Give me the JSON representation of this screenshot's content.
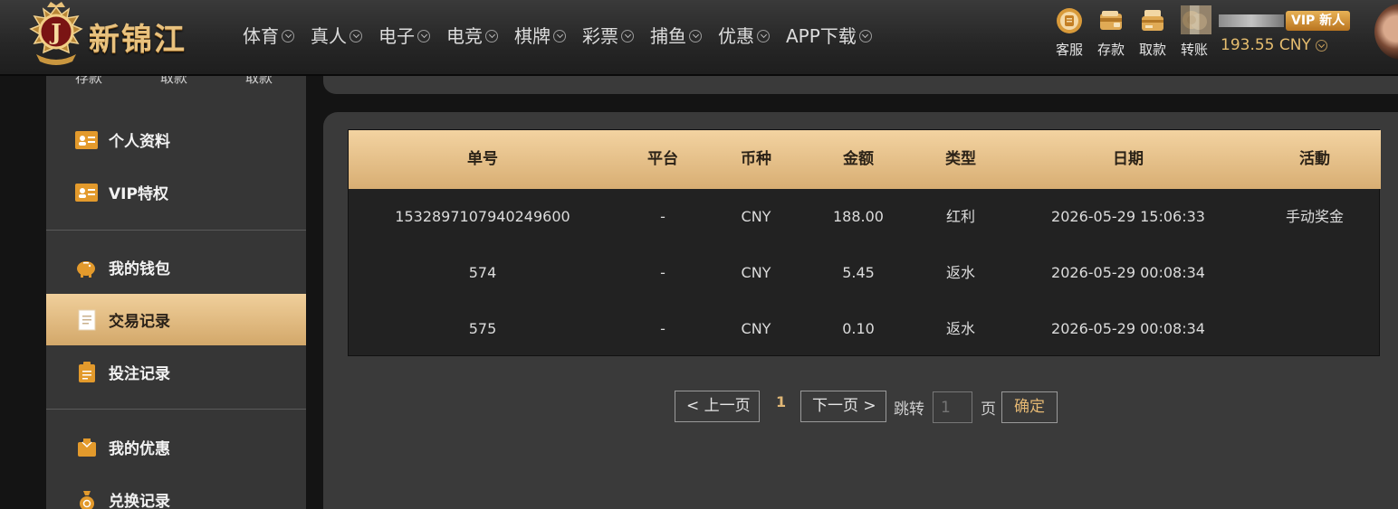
{
  "header": {
    "logo_text": "新锦江",
    "logo_badge_letter": "J",
    "nav": [
      {
        "label": "体育"
      },
      {
        "label": "真人"
      },
      {
        "label": "电子"
      },
      {
        "label": "电竞"
      },
      {
        "label": "棋牌"
      },
      {
        "label": "彩票"
      },
      {
        "label": "捕鱼"
      },
      {
        "label": "优惠"
      },
      {
        "label": "APP下载"
      }
    ],
    "tools": [
      {
        "label": "客服",
        "icon": "customer-service-icon"
      },
      {
        "label": "存款",
        "icon": "wallet-deposit-icon"
      },
      {
        "label": "取款",
        "icon": "withdraw-card-icon"
      },
      {
        "label": "转账",
        "icon": "transfer-icon"
      }
    ],
    "vip_badge": "VIP 新人",
    "balance": "193.55 CNY"
  },
  "sidebar": {
    "cut_top": [
      "存款",
      "取款",
      "取款"
    ],
    "items": [
      {
        "label": "个人资料",
        "icon": "id-card-icon",
        "active": false
      },
      {
        "label": "VIP特权",
        "icon": "id-card-icon",
        "active": false
      },
      {
        "label": "我的钱包",
        "icon": "piggy-bank-icon",
        "active": false
      },
      {
        "label": "交易记录",
        "icon": "document-icon",
        "active": true
      },
      {
        "label": "投注记录",
        "icon": "clipboard-icon",
        "active": false
      },
      {
        "label": "我的优惠",
        "icon": "gift-bag-icon",
        "active": false
      },
      {
        "label": "兑换记录",
        "icon": "money-bag-icon",
        "active": false
      }
    ]
  },
  "table": {
    "columns": [
      "单号",
      "平台",
      "币种",
      "金额",
      "类型",
      "日期",
      "活動"
    ],
    "rows": [
      [
        "1532897107940249600",
        "-",
        "CNY",
        "188.00",
        "红利",
        "2026-05-29 15:06:33",
        "手动奖金"
      ],
      [
        "574",
        "-",
        "CNY",
        "5.45",
        "返水",
        "2026-05-29 00:08:34",
        ""
      ],
      [
        "575",
        "-",
        "CNY",
        "0.10",
        "返水",
        "2026-05-29 00:08:34",
        ""
      ]
    ]
  },
  "pagination": {
    "prev_label": "< 上一页",
    "current_page": "1",
    "next_label": "下一页 >",
    "jump_label": "跳转",
    "input_placeholder": "1",
    "page_suffix": "页",
    "confirm_label": "确定"
  },
  "colors": {
    "accent_gold": "#e0b776",
    "header_bar": "#f3d3a1",
    "panel_bg": "#3a3a3a",
    "table_bg": "#222222"
  }
}
